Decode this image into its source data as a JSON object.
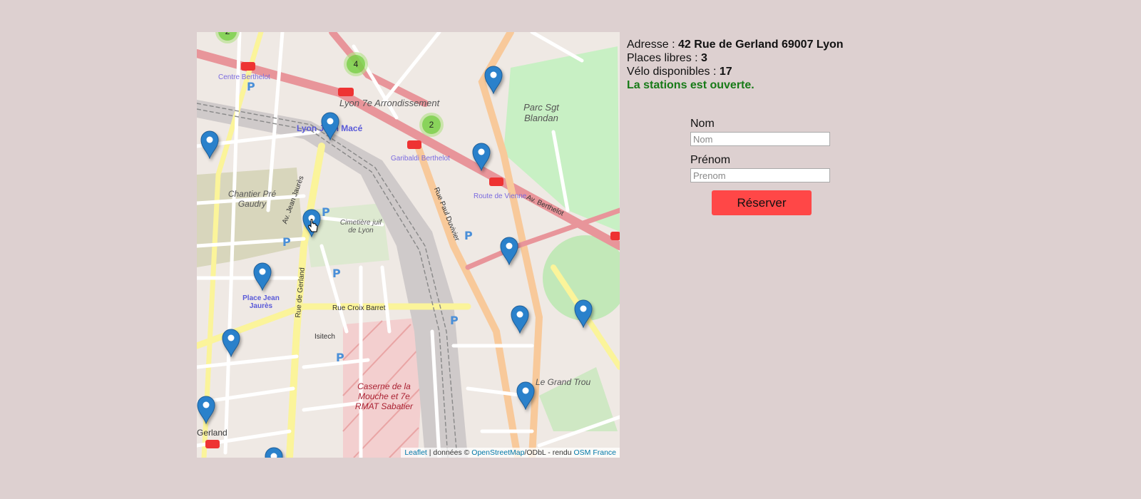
{
  "map": {
    "attribution": {
      "leaflet": "Leaflet",
      "sep1": " | données © ",
      "osm": "OpenStreetMap",
      "sep2": "/ODbL - rendu ",
      "osmfr": "OSM France"
    },
    "clusters": [
      "2",
      "4",
      "2"
    ],
    "labels": {
      "arrondissement": "Lyon 7e Arrondissement",
      "parc": "Parc Sgt Blandan",
      "chantier": "Chantier Pré Gaudry",
      "cimetiere": "Cimetière juif de Lyon",
      "caserne": "Caserne de la Mouche et 7e RMAT Sabatier",
      "jeanmace": "Lyon Jean Macé",
      "placejeanjaures": "Place Jean Jaurès",
      "grandtrou": "Le Grand Trou",
      "routevienne": "Route de Vienne",
      "garibaldi": "Garibaldi Berthelot",
      "centreberthelot": "Centre Berthelot",
      "crossbarret": "Rue Croix Barret",
      "avjeanjaures": "Av. Jean Jaurès",
      "ruegerland": "Rue de Gerland",
      "ruepauldu": "Rue Paul Duvivier",
      "avberthelot": "Av. Berthelot",
      "isitech": "Isitech",
      "gerland": "Gerland"
    }
  },
  "station": {
    "address_label": "Adresse : ",
    "address": "42 Rue de Gerland 69007 Lyon",
    "places_label": "Places libres : ",
    "places": "3",
    "bikes_label": "Vélo disponibles : ",
    "bikes": "17",
    "status": "La stations est ouverte."
  },
  "form": {
    "nom_label": "Nom",
    "nom_placeholder": "Nom",
    "prenom_label": "Prénom",
    "prenom_placeholder": "Prenom",
    "submit": "Réserver"
  },
  "colors": {
    "background": "#ddd0d0",
    "button": "#ff4747",
    "status": "#177a17",
    "pin": "#2a81cb"
  }
}
